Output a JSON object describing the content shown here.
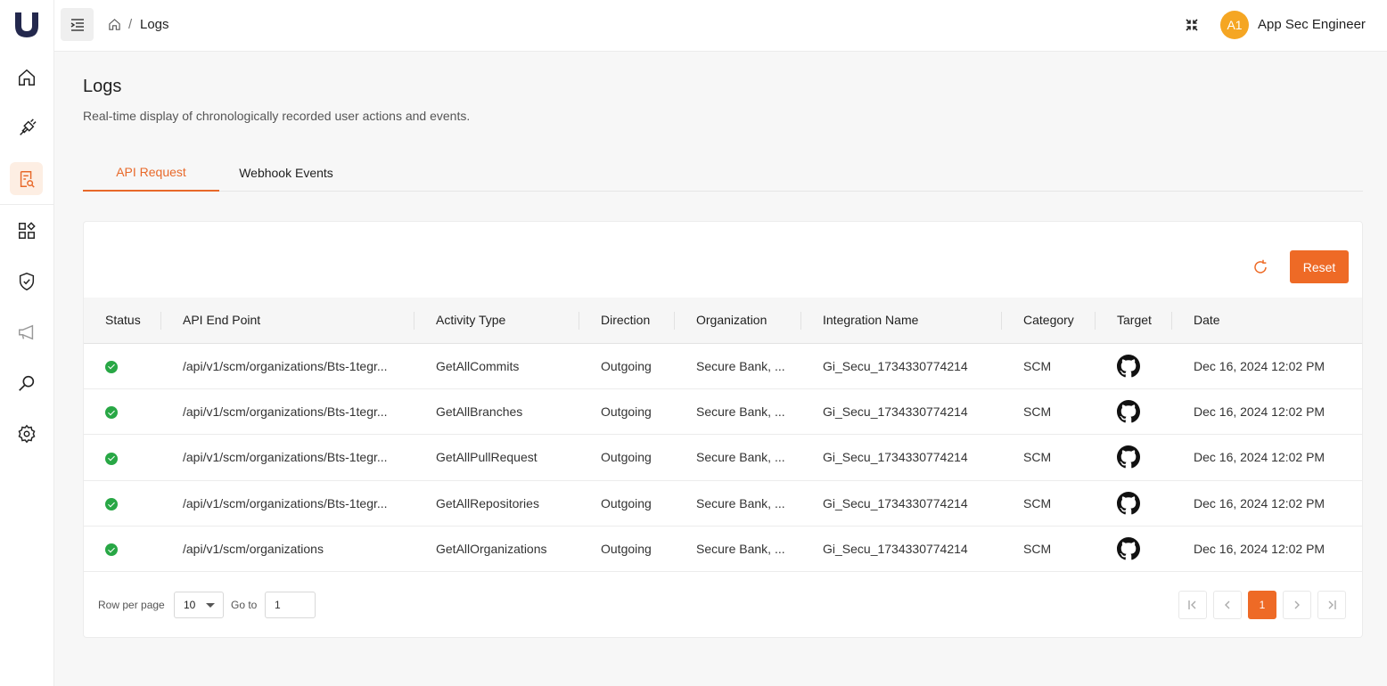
{
  "breadcrumb": {
    "current": "Logs",
    "separator": "/"
  },
  "user": {
    "initials": "A1",
    "name": "App Sec Engineer"
  },
  "page": {
    "title": "Logs",
    "subtitle": "Real-time display of chronologically recorded user actions and events."
  },
  "tabs": [
    {
      "label": "API Request",
      "active": true
    },
    {
      "label": "Webhook Events",
      "active": false
    }
  ],
  "toolbar": {
    "reset_label": "Reset"
  },
  "table": {
    "columns": [
      "Status",
      "API End Point",
      "Activity Type",
      "Direction",
      "Organization",
      "Integration Name",
      "Category",
      "Target",
      "Date"
    ],
    "rows": [
      {
        "status": "success",
        "endpoint": "/api/v1/scm/organizations/Bts-1tegr...",
        "activity": "GetAllCommits",
        "direction": "Outgoing",
        "organization": "Secure Bank, ...",
        "integration": "Gi_Secu_1734330774214",
        "category": "SCM",
        "target_icon": "github-icon",
        "date": "Dec 16, 2024 12:02 PM"
      },
      {
        "status": "success",
        "endpoint": "/api/v1/scm/organizations/Bts-1tegr...",
        "activity": "GetAllBranches",
        "direction": "Outgoing",
        "organization": "Secure Bank, ...",
        "integration": "Gi_Secu_1734330774214",
        "category": "SCM",
        "target_icon": "github-icon",
        "date": "Dec 16, 2024 12:02 PM"
      },
      {
        "status": "success",
        "endpoint": "/api/v1/scm/organizations/Bts-1tegr...",
        "activity": "GetAllPullRequest",
        "direction": "Outgoing",
        "organization": "Secure Bank, ...",
        "integration": "Gi_Secu_1734330774214",
        "category": "SCM",
        "target_icon": "github-icon",
        "date": "Dec 16, 2024 12:02 PM"
      },
      {
        "status": "success",
        "endpoint": "/api/v1/scm/organizations/Bts-1tegr...",
        "activity": "GetAllRepositories",
        "direction": "Outgoing",
        "organization": "Secure Bank, ...",
        "integration": "Gi_Secu_1734330774214",
        "category": "SCM",
        "target_icon": "github-icon",
        "date": "Dec 16, 2024 12:02 PM"
      },
      {
        "status": "success",
        "endpoint": "/api/v1/scm/organizations",
        "activity": "GetAllOrganizations",
        "direction": "Outgoing",
        "organization": "Secure Bank, ...",
        "integration": "Gi_Secu_1734330774214",
        "category": "SCM",
        "target_icon": "github-icon",
        "date": "Dec 16, 2024 12:02 PM"
      }
    ]
  },
  "pagination": {
    "rows_label": "Row per page",
    "rows_value": "10",
    "goto_label": "Go to",
    "goto_value": "1",
    "current_page": "1"
  },
  "colors": {
    "accent": "#ee6a26",
    "success": "#28a745",
    "avatar": "#f5a623"
  }
}
